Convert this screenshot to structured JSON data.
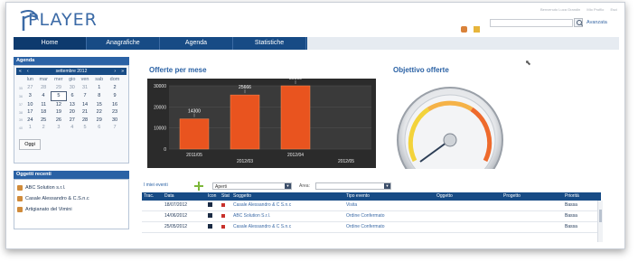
{
  "app": {
    "logo": "PLAYER"
  },
  "toplinks": [
    "Benvenuto Luca Grandin",
    "Mio Profilo",
    "Esci"
  ],
  "search": {
    "value": "",
    "advanced_label": "Avanzata"
  },
  "nav": [
    {
      "label": "Home",
      "active": true
    },
    {
      "label": "Anagrafiche"
    },
    {
      "label": "Agenda"
    },
    {
      "label": "Statistiche"
    }
  ],
  "sidebar": {
    "agenda_title": "Agenda",
    "calendar": {
      "month": "settembre 2012",
      "prev_year": "«",
      "prev": "‹",
      "next": "›",
      "next_year": "»",
      "weekdays": [
        "lun",
        "mar",
        "mer",
        "gio",
        "ven",
        "sab",
        "dom"
      ],
      "weeks": [
        {
          "wk": "35",
          "days": [
            "27",
            "28",
            "29",
            "30",
            "31",
            "1",
            "2"
          ]
        },
        {
          "wk": "36",
          "days": [
            "3",
            "4",
            "5",
            "6",
            "7",
            "8",
            "9"
          ]
        },
        {
          "wk": "37",
          "days": [
            "10",
            "11",
            "12",
            "13",
            "14",
            "15",
            "16"
          ]
        },
        {
          "wk": "38",
          "days": [
            "17",
            "18",
            "19",
            "20",
            "21",
            "22",
            "23"
          ]
        },
        {
          "wk": "39",
          "days": [
            "24",
            "25",
            "26",
            "27",
            "28",
            "29",
            "30"
          ]
        },
        {
          "wk": "40",
          "days": [
            "1",
            "2",
            "3",
            "4",
            "5",
            "6",
            "7"
          ]
        }
      ],
      "selected_day": "5",
      "today_label": "Oggi"
    },
    "recent_title": "Oggetti recenti",
    "recent": [
      "ABC Solution s.r.l.",
      "Casale Alessandro & C.S.n.c",
      "Artigianato del Vimini"
    ]
  },
  "chart_data": {
    "type": "bar",
    "title": "Offerte per mese",
    "categories": [
      "2011/05",
      "2012/03",
      "2012/04",
      "2012/05"
    ],
    "values": [
      14300,
      25666,
      30000,
      0
    ],
    "value_labels": [
      "14300",
      "25666",
      "30000",
      ""
    ],
    "ylim": [
      0,
      30000
    ],
    "yticks": [
      "0",
      "10000",
      "20000",
      "30000"
    ],
    "colors": {
      "bar": "#e9541f",
      "bg": "#2b2b2b"
    }
  },
  "gauge": {
    "title": "Objettivo offerte"
  },
  "grid": {
    "toolbar_label": "I miei eventi",
    "status_value": "Aperti",
    "area_label": "Area:",
    "area_value": "",
    "columns": [
      "Trac.",
      "Data",
      "Icon",
      "Stat",
      "Soggetto",
      "Tipo evento",
      "Oggetto",
      "Progetto",
      "Priorità"
    ],
    "rows": [
      {
        "data": "18/07/2012",
        "soggetto": "Casale Alessandro & C S.n.c",
        "tipo": "Visita",
        "priorita": "Bassa"
      },
      {
        "data": "14/06/2012",
        "soggetto": "ABC Solution S.r.l.",
        "tipo": "Ordine Confermato",
        "priorita": "Bassa"
      },
      {
        "data": "25/05/2012",
        "soggetto": "Casale Alessandro & C S.n.c",
        "tipo": "Ordine Confermato",
        "priorita": "Bassa"
      }
    ]
  }
}
